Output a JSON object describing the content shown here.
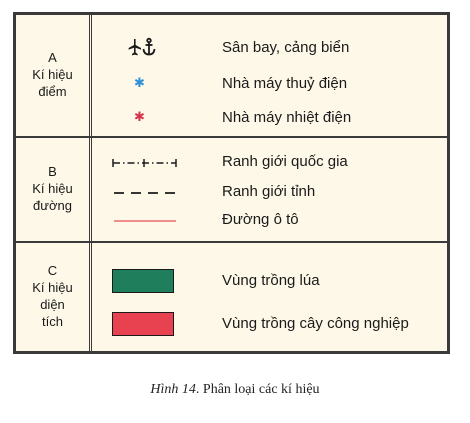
{
  "legend": {
    "sections": [
      {
        "letter": "A",
        "title_lines": [
          "Kí hiệu",
          "điểm"
        ],
        "items": [
          {
            "label": "Sân bay, cảng biển",
            "symbol": "airport-seaport-icon",
            "color": "#1a1a1a"
          },
          {
            "label": "Nhà máy thuỷ điện",
            "symbol": "blue-star-icon",
            "color": "#2f8fd6"
          },
          {
            "label": "Nhà máy nhiệt điện",
            "symbol": "red-star-icon",
            "color": "#d6344a"
          }
        ]
      },
      {
        "letter": "B",
        "title_lines": [
          "Kí hiệu",
          "đường"
        ],
        "items": [
          {
            "label": "Ranh giới quốc gia",
            "symbol": "dash-dot-line",
            "color": "#1a1a1a"
          },
          {
            "label": "Ranh giới tỉnh",
            "symbol": "dashed-line",
            "color": "#1a1a1a"
          },
          {
            "label": "Đường ô tô",
            "symbol": "solid-red-line",
            "color": "#e86a6a"
          }
        ]
      },
      {
        "letter": "C",
        "title_lines": [
          "Kí hiệu",
          "diện",
          "tích"
        ],
        "items": [
          {
            "label": "Vùng trồng lúa",
            "symbol": "green-area-swatch",
            "color": "#1f7f5c"
          },
          {
            "label": "Vùng trồng cây công nghiệp",
            "symbol": "red-area-swatch",
            "color": "#e8414f"
          }
        ]
      }
    ]
  },
  "caption": {
    "prefix": "Hình 14",
    "text": ". Phân loại các kí hiệu"
  },
  "colors": {
    "background": "#fdf8e8",
    "border": "#3a3a3a"
  }
}
